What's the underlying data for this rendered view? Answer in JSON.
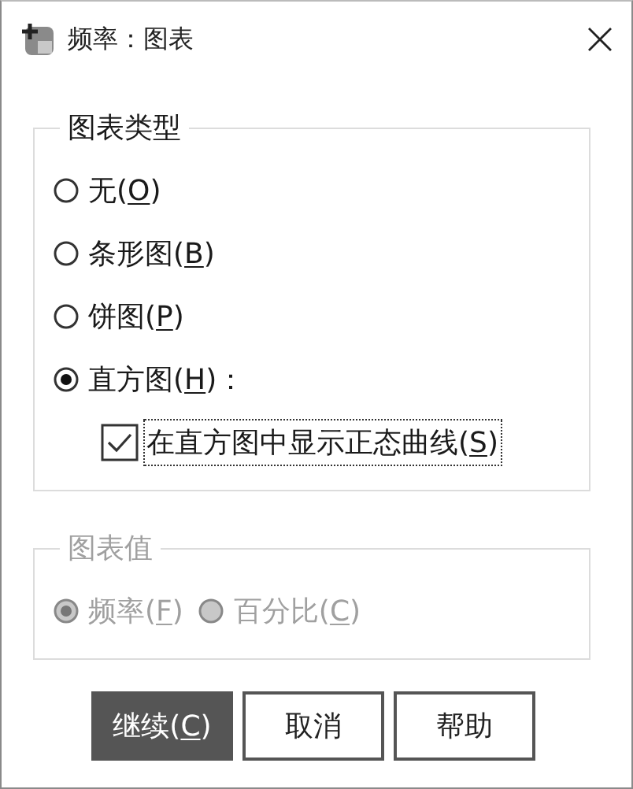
{
  "window": {
    "title": "频率：图表"
  },
  "chart_type": {
    "title": "图表类型",
    "options": [
      {
        "before": "无(",
        "key": "O",
        "after": ")",
        "selected": false
      },
      {
        "before": "条形图(",
        "key": "B",
        "after": ")",
        "selected": false
      },
      {
        "before": "饼图(",
        "key": "P",
        "after": ")",
        "selected": false
      },
      {
        "before": "直方图(",
        "key": "H",
        "after": ")：",
        "selected": true
      }
    ],
    "normal_curve": {
      "before": "在直方图中显示正态曲线(",
      "key": "S",
      "after": ")",
      "checked": true,
      "focused": true
    }
  },
  "chart_values": {
    "title": "图表值",
    "disabled": true,
    "options": [
      {
        "before": "频率(",
        "key": "F",
        "after": ")",
        "selected": true
      },
      {
        "before": "百分比(",
        "key": "C",
        "after": ")",
        "selected": false
      }
    ]
  },
  "buttons": [
    {
      "before": "继续(",
      "key": "C",
      "after": ")",
      "default": true
    },
    {
      "before": "取消",
      "default": false
    },
    {
      "before": "帮助",
      "default": false
    }
  ]
}
